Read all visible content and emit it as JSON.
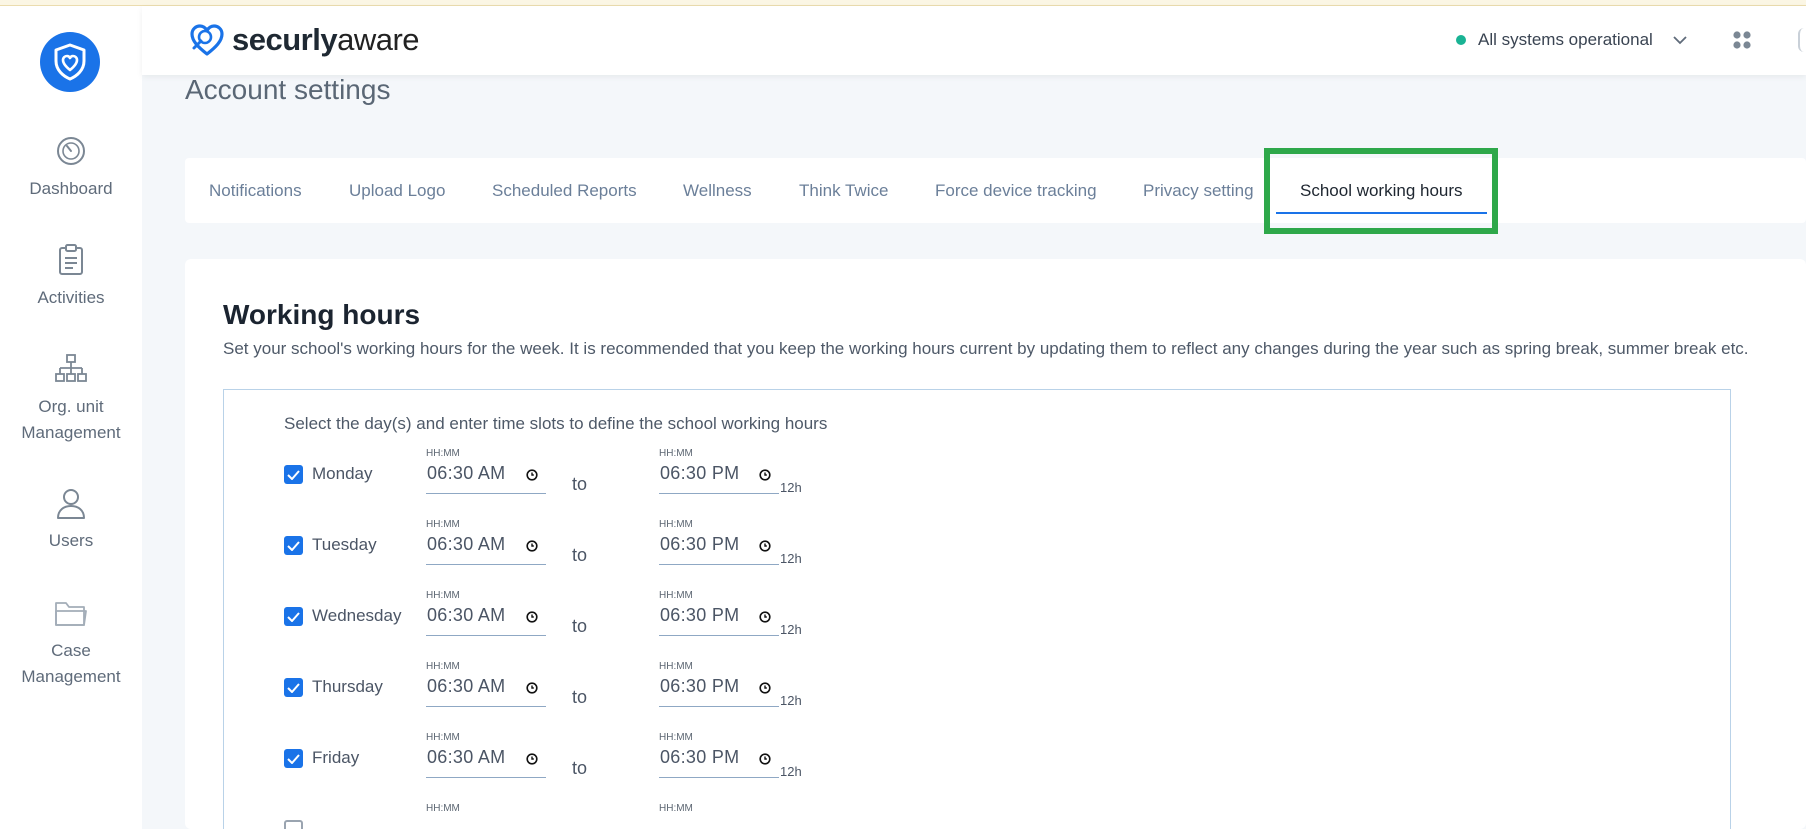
{
  "header": {
    "logo_bold": "securly",
    "logo_light": "aware",
    "status_text": "All systems operational"
  },
  "sidebar": {
    "items": [
      {
        "label": "Dashboard",
        "icon": "gauge-icon"
      },
      {
        "label": "Activities",
        "icon": "clipboard-icon"
      },
      {
        "label": "Org. unit Management",
        "icon": "org-chart-icon"
      },
      {
        "label": "Users",
        "icon": "user-icon"
      },
      {
        "label": "Case Management",
        "icon": "folder-icon"
      }
    ]
  },
  "page": {
    "title": "Account settings"
  },
  "tabs": [
    {
      "label": "Notifications"
    },
    {
      "label": "Upload Logo"
    },
    {
      "label": "Scheduled Reports"
    },
    {
      "label": "Wellness"
    },
    {
      "label": "Think Twice"
    },
    {
      "label": "Force device tracking"
    },
    {
      "label": "Privacy setting"
    },
    {
      "label": "School working hours",
      "active": true
    }
  ],
  "working_hours": {
    "title": "Working hours",
    "description": "Set your school's working hours for the week. It is recommended that you keep the working hours current by updating them to reflect any changes during the year such as spring break, summer break etc.",
    "instructions": "Select the day(s) and enter time slots to define the school working hours",
    "time_caption": "HH:MM",
    "to_label": "to",
    "format_label": "12h",
    "days": [
      {
        "day": "Monday",
        "checked": true,
        "start": "06:30  AM",
        "end": "06:30  PM"
      },
      {
        "day": "Tuesday",
        "checked": true,
        "start": "06:30  AM",
        "end": "06:30  PM"
      },
      {
        "day": "Wednesday",
        "checked": true,
        "start": "06:30  AM",
        "end": "06:30  PM"
      },
      {
        "day": "Thursday",
        "checked": true,
        "start": "06:30  AM",
        "end": "06:30  PM"
      },
      {
        "day": "Friday",
        "checked": true,
        "start": "06:30  AM",
        "end": "06:30  PM"
      }
    ]
  },
  "colors": {
    "accent": "#1a73e8",
    "status_green": "#19b394",
    "highlight_green": "#2ea84a"
  }
}
